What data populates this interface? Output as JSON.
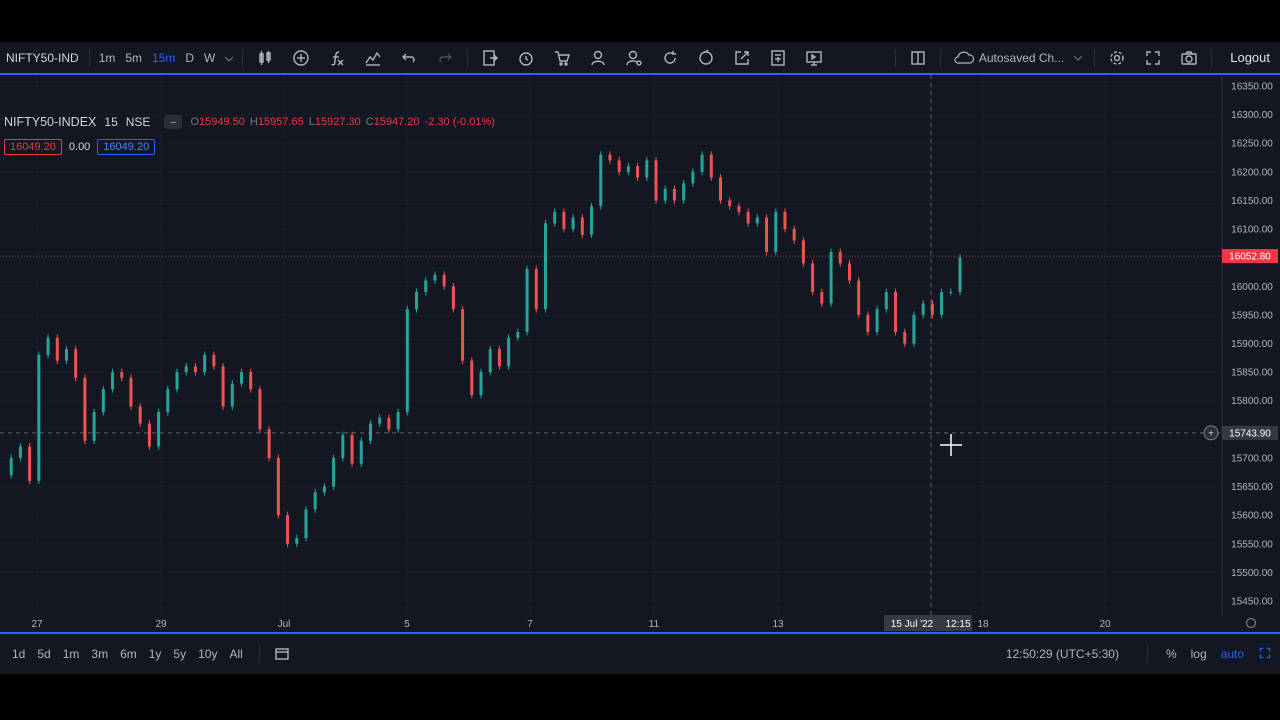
{
  "toolbar": {
    "symbol": "NIFTY50-IND",
    "intervals": [
      "1m",
      "5m",
      "15m",
      "D",
      "W"
    ],
    "active_interval": "15m",
    "autosave_label": "Autosaved Ch...",
    "logout_label": "Logout"
  },
  "legend": {
    "name": "NIFTY50-INDEX",
    "timeframe": "15",
    "exchange": "NSE",
    "o_label": "O",
    "o": "15949.50",
    "h_label": "H",
    "h": "15957.65",
    "l_label": "L",
    "l": "15927.30",
    "c_label": "C",
    "c": "15947.20",
    "change": "-2.30 (-0.01%)",
    "bid": "16049.20",
    "spread": "0.00",
    "ask": "16049.20"
  },
  "price_axis": {
    "ticks": [
      "16350.00",
      "16300.00",
      "16250.00",
      "16200.00",
      "16150.00",
      "16100.00",
      "16050.00",
      "16000.00",
      "15950.00",
      "15900.00",
      "15850.00",
      "15800.00",
      "15750.00",
      "15700.00",
      "15650.00",
      "15600.00",
      "15550.00",
      "15500.00",
      "15450.00"
    ],
    "last_price_label": "16052.80",
    "crosshair_price_label": "15743.90"
  },
  "time_axis": {
    "ticks": [
      "27",
      "29",
      "Jul",
      "5",
      "7",
      "11",
      "13",
      "18",
      "20"
    ],
    "crosshair_date": "15 Jul '22",
    "crosshair_time": "12:15"
  },
  "bottombar": {
    "ranges": [
      "1d",
      "5d",
      "1m",
      "3m",
      "6m",
      "1y",
      "5y",
      "10y",
      "All"
    ],
    "clock": "12:50:29 (UTC+5:30)",
    "percent_label": "%",
    "log_label": "log",
    "auto_label": "auto"
  },
  "colors": {
    "up": "#26a69a",
    "down": "#ef5350",
    "accent": "#2962ff",
    "background": "#131722"
  },
  "chart_data": {
    "type": "line",
    "x_unit": "15m bar index",
    "series": [
      {
        "values": [
          15670,
          15700,
          15720,
          15660,
          15880,
          15910,
          15870,
          15890,
          15840,
          15730,
          15780,
          15820,
          15850,
          15840,
          15790,
          15760,
          15720,
          15780,
          15820,
          15850,
          15860,
          15850,
          15880,
          15860,
          15790,
          15830,
          15850,
          15820,
          15750,
          15700,
          15600,
          15550,
          15560,
          15610,
          15640,
          15650,
          15700,
          15740,
          15690,
          15730,
          15760,
          15770,
          15750,
          15780,
          15960,
          15990,
          16010,
          16020,
          16000,
          15960,
          15870,
          15810,
          15850,
          15890,
          15860,
          15910,
          15920,
          16030,
          15960,
          16110,
          16130,
          16100,
          16120,
          16090,
          16140,
          16230,
          16220,
          16200,
          16210,
          16190,
          16220,
          16150,
          16170,
          16150,
          16180,
          16200,
          16230,
          16190,
          16150,
          16140,
          16130,
          16110,
          16120,
          16060,
          16130,
          16100,
          16080,
          16040,
          15990,
          15970,
          16060,
          16040,
          16010,
          15950,
          15920,
          15960,
          15990,
          15920,
          15900,
          15950,
          15970,
          15950,
          15990,
          15990,
          16050
        ]
      }
    ]
  }
}
